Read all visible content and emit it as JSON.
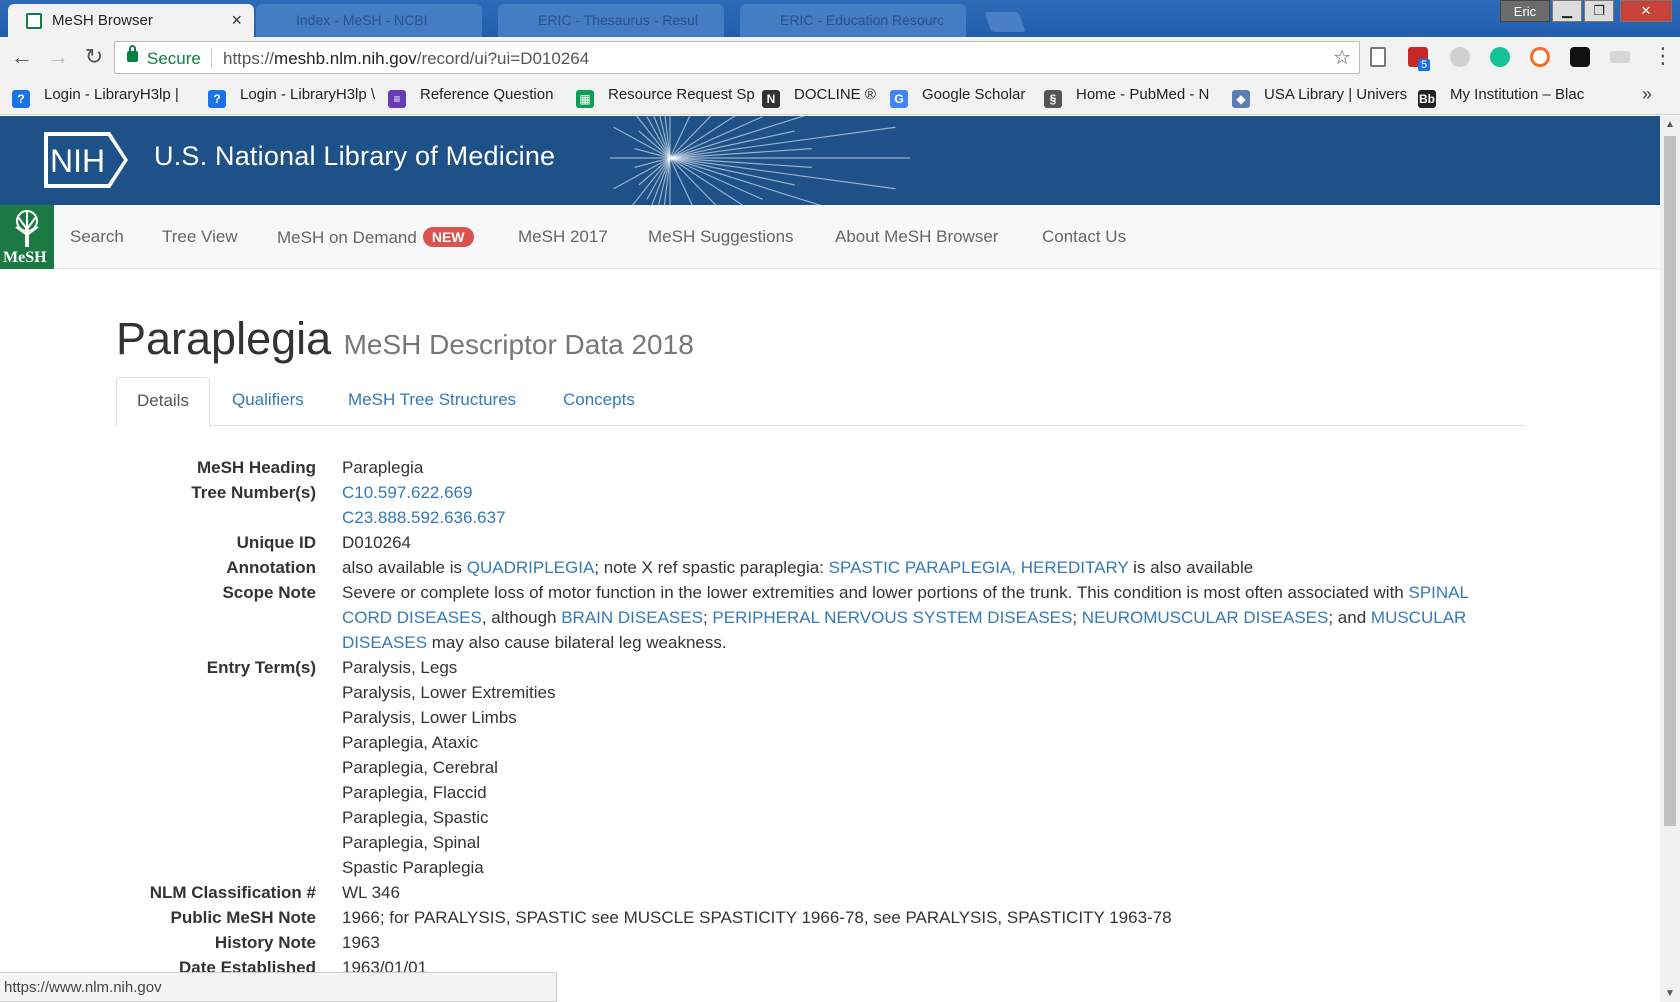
{
  "browser": {
    "active_tab_title": "MeSH Browser",
    "bg_tabs": [
      "Index - MeSH - NCBI",
      "ERIC - Thesaurus - Resul",
      "ERIC - Education Resourc"
    ],
    "user": "Eric",
    "secure_label": "Secure",
    "url_scheme": "https://",
    "url_host": "meshb.nlm.nih.gov",
    "url_path": "/record/ui?ui=D010264",
    "extension_badge": "5",
    "status_url": "https://www.nlm.nih.gov"
  },
  "bookmarks": [
    {
      "label": "Login - LibraryH3lp |",
      "icon": "question-icon",
      "color": "#1a73e8"
    },
    {
      "label": "Login - LibraryH3lp \\",
      "icon": "question-icon",
      "color": "#1a73e8"
    },
    {
      "label": "Reference Question",
      "icon": "form-icon",
      "color": "#673ab7"
    },
    {
      "label": "Resource Request Sp",
      "icon": "sheet-icon",
      "color": "#0f9d58"
    },
    {
      "label": "DOCLINE ®",
      "icon": "nlm-icon",
      "color": "#333333"
    },
    {
      "label": "Google Scholar",
      "icon": "scholar-icon",
      "color": "#4285f4"
    },
    {
      "label": "Home - PubMed - N",
      "icon": "pubmed-icon",
      "color": "#555555"
    },
    {
      "label": "USA Library | Univers",
      "icon": "shield-icon",
      "color": "#5b7fb5"
    },
    {
      "label": "My Institution – Blac",
      "icon": "bb-icon",
      "color": "#222222"
    }
  ],
  "site": {
    "banner_title": "U.S. National Library of Medicine",
    "nih_logo_text": "NIH",
    "mesh_logo_text": "MeSH",
    "nav": [
      "Search",
      "Tree View",
      "MeSH on Demand",
      "MeSH 2017",
      "MeSH Suggestions",
      "About MeSH Browser",
      "Contact Us"
    ],
    "new_badge": "NEW"
  },
  "record": {
    "title": "Paraplegia",
    "subtitle": "MeSH Descriptor Data 2018",
    "tabs": [
      "Details",
      "Qualifiers",
      "MeSH Tree Structures",
      "Concepts"
    ],
    "fields": {
      "mesh_heading_label": "MeSH Heading",
      "mesh_heading": "Paraplegia",
      "tree_numbers_label": "Tree Number(s)",
      "tree_numbers": [
        "C10.597.622.669",
        "C23.888.592.636.637"
      ],
      "unique_id_label": "Unique ID",
      "unique_id": "D010264",
      "annotation_label": "Annotation",
      "annotation_1": "also available is ",
      "annotation_link_1": "QUADRIPLEGIA",
      "annotation_2": "; note X ref spastic paraplegia: ",
      "annotation_link_2": "SPASTIC PARAPLEGIA, HEREDITARY",
      "annotation_3": " is also available",
      "scope_note_label": "Scope Note",
      "scope_1": "Severe or complete loss of motor function in the lower extremities and lower portions of the trunk. This condition is most often associated with ",
      "scope_link_1": "SPINAL CORD DISEASES",
      "scope_2": ", although ",
      "scope_link_2": "BRAIN DISEASES",
      "scope_3": "; ",
      "scope_link_3": "PERIPHERAL NERVOUS SYSTEM DISEASES",
      "scope_4": "; ",
      "scope_link_4": "NEUROMUSCULAR DISEASES",
      "scope_5": "; and ",
      "scope_link_5": "MUSCULAR DISEASES",
      "scope_6": " may also cause bilateral leg weakness.",
      "entry_terms_label": "Entry Term(s)",
      "entry_terms": [
        "Paralysis, Legs",
        "Paralysis, Lower Extremities",
        "Paralysis, Lower Limbs",
        "Paraplegia, Ataxic",
        "Paraplegia, Cerebral",
        "Paraplegia, Flaccid",
        "Paraplegia, Spastic",
        "Paraplegia, Spinal",
        "Spastic Paraplegia"
      ],
      "nlm_class_label": "NLM Classification #",
      "nlm_class": "WL 346",
      "public_note_label": "Public MeSH Note",
      "public_note": "1966; for PARALYSIS, SPASTIC see MUSCLE SPASTICITY 1966-78, see PARALYSIS, SPASTICITY 1963-78",
      "history_note_label": "History Note",
      "history_note": "1963",
      "date_established_label": "Date Established",
      "date_established": "1963/01/01"
    }
  },
  "colors": {
    "banner": "#1d5188",
    "link": "#337ab7",
    "mesh_green": "#1b7a44",
    "badge_red": "#d9534f"
  }
}
